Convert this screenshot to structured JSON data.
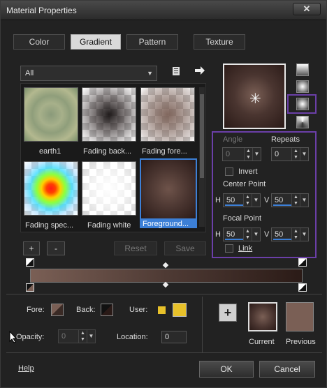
{
  "window": {
    "title": "Material Properties",
    "close": "✕"
  },
  "tabs": [
    {
      "label": "Color"
    },
    {
      "label": "Gradient"
    },
    {
      "label": "Pattern"
    },
    {
      "label": "Texture"
    }
  ],
  "library": {
    "dropdown_value": "All",
    "items": [
      {
        "label": "earth1"
      },
      {
        "label": "Fading back..."
      },
      {
        "label": "Fading fore..."
      },
      {
        "label": "Fading spec..."
      },
      {
        "label": "Fading white"
      },
      {
        "label": "Foreground..."
      }
    ],
    "add_label": "+",
    "remove_label": "-",
    "reset_label": "Reset",
    "save_label": "Save"
  },
  "style_options": {
    "angle_label": "Angle",
    "angle_value": "0",
    "repeats_label": "Repeats",
    "repeats_value": "0",
    "invert_label": "Invert",
    "center_point_label": "Center Point",
    "center_h_label": "H",
    "center_h_value": "50",
    "center_v_label": "V",
    "center_v_value": "50",
    "focal_point_label": "Focal Point",
    "focal_h_label": "H",
    "focal_h_value": "50",
    "focal_v_label": "V",
    "focal_v_value": "50",
    "link_label": "Link"
  },
  "bottom": {
    "fore_label": "Fore:",
    "back_label": "Back:",
    "user_label": "User:",
    "opacity_label": "Opacity:",
    "opacity_value": "0",
    "location_label": "Location:",
    "location_value": "0",
    "current_label": "Current",
    "previous_label": "Previous",
    "plus_label": "+"
  },
  "footer": {
    "help_label": "Help",
    "ok_label": "OK",
    "cancel_label": "Cancel"
  },
  "colors": {
    "accent_purple": "#6b3fa8",
    "highlight_blue": "#3c7fd6",
    "gradient_fore": "#7a5f55",
    "gradient_back": "#2b1b17",
    "user_color": "#e8c12a"
  }
}
